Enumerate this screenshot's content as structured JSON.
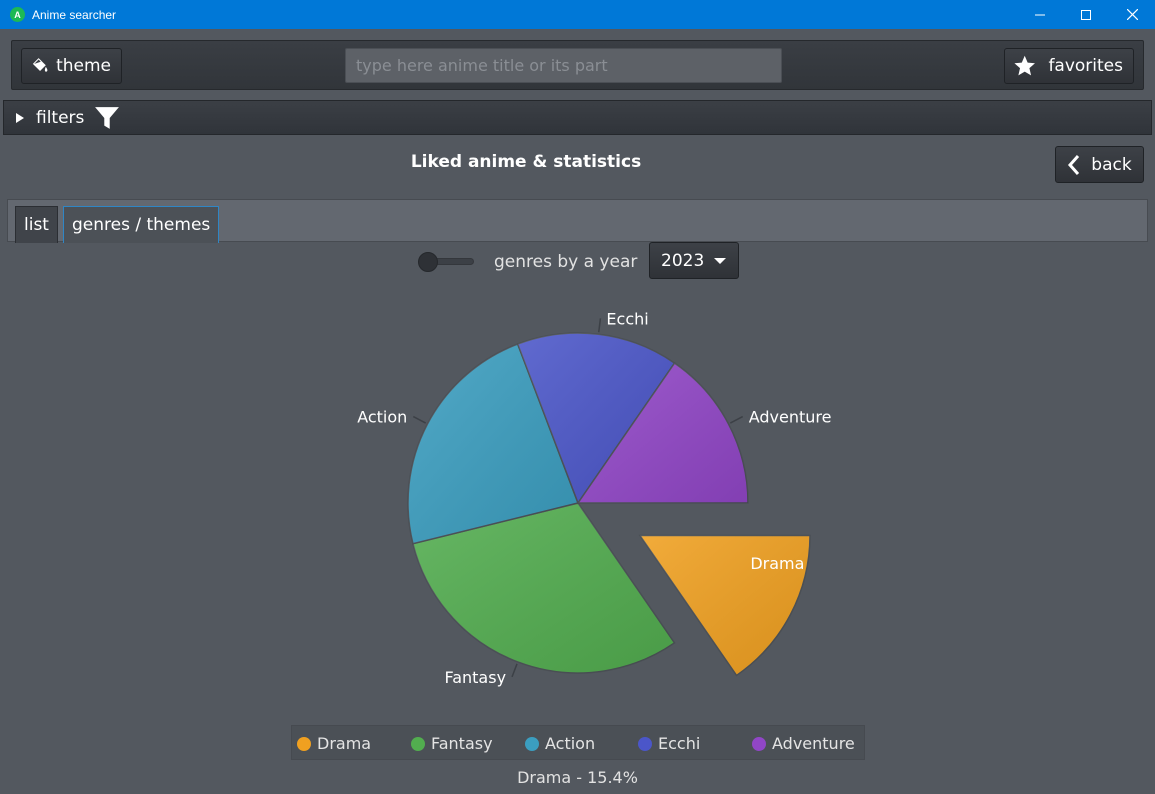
{
  "window": {
    "title": "Anime searcher",
    "app_icon_letter": "A"
  },
  "toolbar": {
    "theme_label": "theme",
    "search_placeholder": "type here anime title or its part",
    "favorites_label": "favorites"
  },
  "filters": {
    "label": "filters"
  },
  "header": {
    "title": "Liked anime & statistics",
    "back_label": "back"
  },
  "tabs": [
    {
      "label": "list"
    },
    {
      "label": "genres / themes"
    }
  ],
  "controls": {
    "toggle_label": "genres by a year",
    "year_value": "2023"
  },
  "chart_data": {
    "type": "pie",
    "title": "",
    "slices": [
      {
        "label": "Drama",
        "value": 15.4,
        "color": "#f0a020",
        "exploded": true
      },
      {
        "label": "Fantasy",
        "value": 30.8,
        "color": "#52ad4f"
      },
      {
        "label": "Action",
        "value": 23.1,
        "color": "#3b9ec0"
      },
      {
        "label": "Ecchi",
        "value": 15.4,
        "color": "#4b56c9"
      },
      {
        "label": "Adventure",
        "value": 15.4,
        "color": "#9146c7"
      }
    ],
    "legend": [
      "Drama",
      "Fantasy",
      "Action",
      "Ecchi",
      "Adventure"
    ],
    "legend_position": "bottom"
  },
  "status": {
    "text": "Drama - 15.4%"
  },
  "colors": {
    "titlebar": "#0078d7",
    "background": "#53585f",
    "accent_tab": "#2f86c5"
  }
}
